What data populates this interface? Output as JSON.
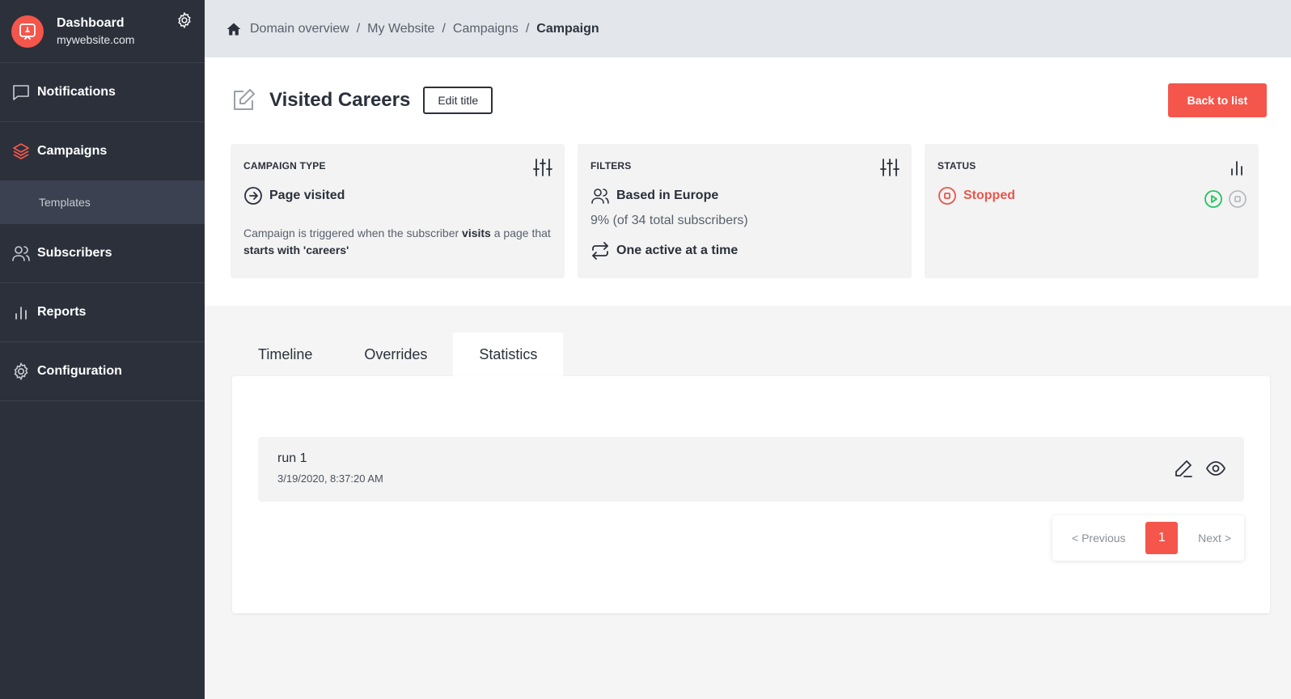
{
  "sidebar": {
    "brand_title": "Dashboard",
    "brand_subtitle": "mywebsite.com",
    "items": [
      {
        "label": "Notifications"
      },
      {
        "label": "Campaigns"
      },
      {
        "label": "Templates"
      },
      {
        "label": "Subscribers"
      },
      {
        "label": "Reports"
      },
      {
        "label": "Configuration"
      }
    ]
  },
  "breadcrumb": {
    "items": [
      "Domain overview",
      "My Website",
      "Campaigns"
    ],
    "current": "Campaign",
    "separator": "/"
  },
  "header": {
    "title": "Visited Careers",
    "edit_title_label": "Edit title",
    "back_label": "Back to list"
  },
  "cards": {
    "campaign_type": {
      "label": "CAMPAIGN TYPE",
      "value": "Page visited",
      "desc_1": "Campaign is triggered when the subscriber",
      "desc_bold_1": "visits",
      "desc_2": "a page that",
      "desc_bold_2": "starts with 'careers'"
    },
    "filters": {
      "label": "FILTERS",
      "value": "Based in Europe",
      "subscribers_text": "9% (of 34 total subscribers)",
      "frequency": "One active at a time"
    },
    "status": {
      "label": "STATUS",
      "value": "Stopped"
    }
  },
  "tabs": [
    {
      "label": "Timeline"
    },
    {
      "label": "Overrides"
    },
    {
      "label": "Statistics"
    }
  ],
  "active_tab": "Statistics",
  "runs": [
    {
      "name": "run 1",
      "date": "3/19/2020, 8:37:20 AM"
    }
  ],
  "pagination": {
    "previous_label": "< Previous",
    "current_page": "1",
    "next_label": "Next >"
  },
  "colors": {
    "accent": "#f4564c",
    "sidebar_bg": "#2b303b",
    "play_green": "#22c55e"
  }
}
